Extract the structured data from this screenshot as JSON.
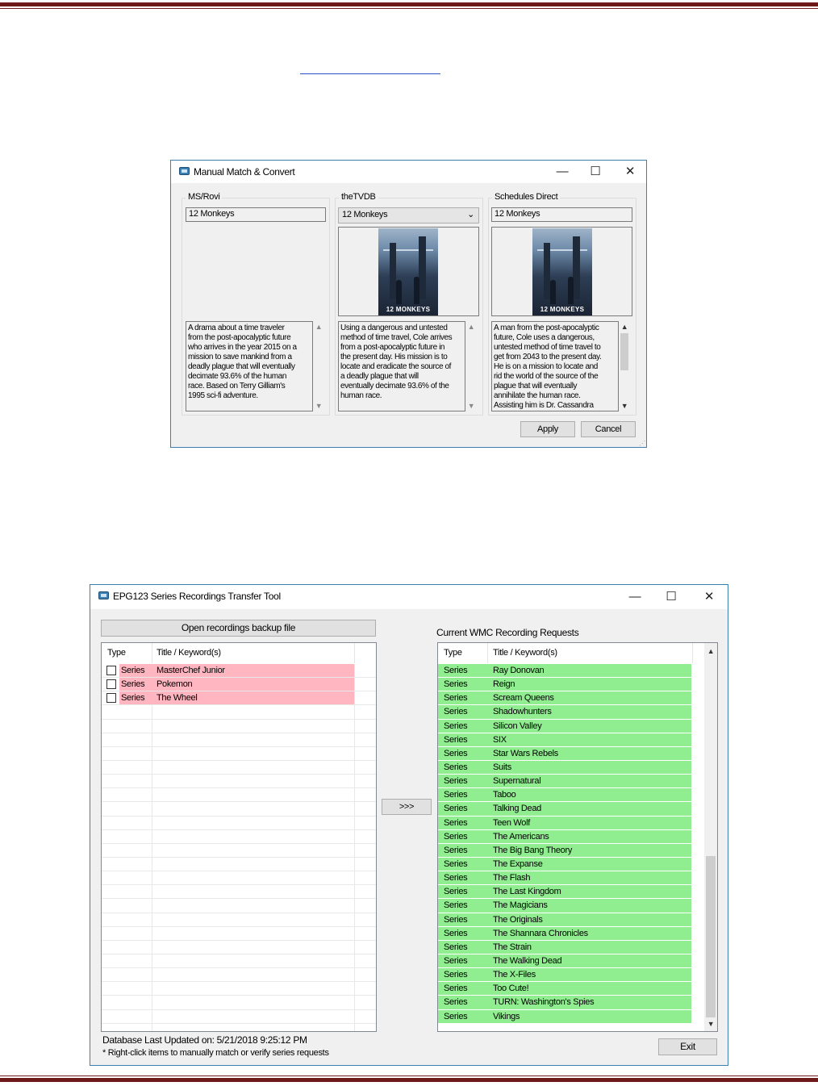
{
  "manual_window": {
    "title": "Manual Match & Convert",
    "minimize_glyph": "—",
    "maximize_glyph": "☐",
    "close_glyph": "✕",
    "columns": [
      {
        "label": "MS/Rovi",
        "title_value": "12 Monkeys",
        "has_poster": false,
        "description": "A drama about a time traveler from the post-apocalyptic future who arrives in the year 2015 on a mission to save mankind from a deadly plague that will eventually decimate 93.6% of the human race. Based on Terry Gilliam's 1995 sci-fi adventure."
      },
      {
        "label": "theTVDB",
        "title_value": "12 Monkeys",
        "has_poster": true,
        "poster_text": "12 MONKEYS",
        "description": "Using a dangerous and untested method of time travel, Cole arrives from a post-apocalyptic future in the present day. His mission is to locate and eradicate the source of a deadly plague that will eventually decimate 93.6% of the human race."
      },
      {
        "label": "Schedules Direct",
        "title_value": "12 Monkeys",
        "has_poster": true,
        "poster_text": "12 MONKEYS",
        "description": "A man from the post-apocalyptic future, Cole uses a dangerous, untested method of time travel to get from 2043 to the present day. He is on a mission to locate and rid the world of the source of the plague that will eventually annihilate the human race. Assisting him is Dr. Cassandra"
      }
    ],
    "apply_label": "Apply",
    "cancel_label": "Cancel"
  },
  "transfer_window": {
    "title": "EPG123 Series Recordings Transfer Tool",
    "minimize_glyph": "—",
    "maximize_glyph": "☐",
    "close_glyph": "✕",
    "open_button_label": "Open recordings backup file",
    "current_label": "Current WMC Recording Requests",
    "left_list": {
      "col_type": "Type",
      "col_title": "Title / Keyword(s)",
      "rows": [
        {
          "type": "Series",
          "title": "MasterChef Junior"
        },
        {
          "type": "Series",
          "title": "Pokemon"
        },
        {
          "type": "Series",
          "title": "The Wheel"
        }
      ]
    },
    "transfer_button_label": ">>>",
    "right_list": {
      "col_type": "Type",
      "col_title": "Title / Keyword(s)",
      "rows": [
        {
          "type": "Series",
          "title": "Ray Donovan"
        },
        {
          "type": "Series",
          "title": "Reign"
        },
        {
          "type": "Series",
          "title": "Scream Queens"
        },
        {
          "type": "Series",
          "title": "Shadowhunters"
        },
        {
          "type": "Series",
          "title": "Silicon Valley"
        },
        {
          "type": "Series",
          "title": "SIX"
        },
        {
          "type": "Series",
          "title": "Star Wars Rebels"
        },
        {
          "type": "Series",
          "title": "Suits"
        },
        {
          "type": "Series",
          "title": "Supernatural"
        },
        {
          "type": "Series",
          "title": "Taboo"
        },
        {
          "type": "Series",
          "title": "Talking Dead"
        },
        {
          "type": "Series",
          "title": "Teen Wolf"
        },
        {
          "type": "Series",
          "title": "The Americans"
        },
        {
          "type": "Series",
          "title": "The Big Bang Theory"
        },
        {
          "type": "Series",
          "title": "The Expanse"
        },
        {
          "type": "Series",
          "title": "The Flash"
        },
        {
          "type": "Series",
          "title": "The Last Kingdom"
        },
        {
          "type": "Series",
          "title": "The Magicians"
        },
        {
          "type": "Series",
          "title": "The Originals"
        },
        {
          "type": "Series",
          "title": "The Shannara Chronicles"
        },
        {
          "type": "Series",
          "title": "The Strain"
        },
        {
          "type": "Series",
          "title": "The Walking Dead"
        },
        {
          "type": "Series",
          "title": "The X-Files"
        },
        {
          "type": "Series",
          "title": "Too Cute!"
        },
        {
          "type": "Series",
          "title": "TURN: Washington's Spies"
        },
        {
          "type": "Series",
          "title": "Vikings"
        }
      ]
    },
    "db_updated": "Database Last Updated on: 5/21/2018 9:25:12 PM",
    "hint": "* Right-click items to manually match or verify series requests",
    "exit_label": "Exit"
  },
  "colors": {
    "unmatched_row": "#ffb6c1",
    "matched_row": "#90ee90",
    "page_rule": "#6e1a1a",
    "window_border": "#3c7fb1"
  }
}
